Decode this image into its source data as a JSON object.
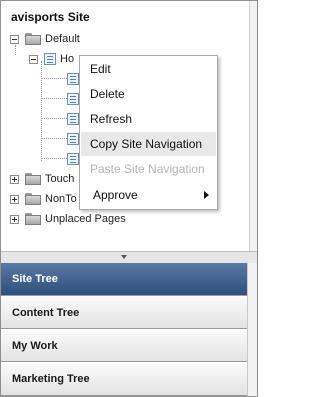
{
  "tree": {
    "site_title": "avisports Site",
    "nodes": {
      "default": "Default",
      "home": "Ho",
      "touch": "Touch",
      "nontouch": "NonTo",
      "unplaced": "Unplaced Pages"
    }
  },
  "context_menu": {
    "items": [
      {
        "label": "Edit",
        "state": "normal"
      },
      {
        "label": "Delete",
        "state": "normal"
      },
      {
        "label": "Refresh",
        "state": "normal"
      },
      {
        "label": "Copy Site Navigation",
        "state": "highlighted"
      },
      {
        "label": "Paste Site Navigation",
        "state": "disabled"
      },
      {
        "label": "Approve",
        "state": "submenu"
      }
    ]
  },
  "accordion": {
    "panels": [
      "Site Tree",
      "Content Tree",
      "My Work",
      "Marketing Tree"
    ],
    "active": "Site Tree"
  },
  "colors": {
    "active_header": "#3e5f8d",
    "menu_highlight": "#e8e8e8",
    "disabled_text": "#b5b5b5"
  }
}
